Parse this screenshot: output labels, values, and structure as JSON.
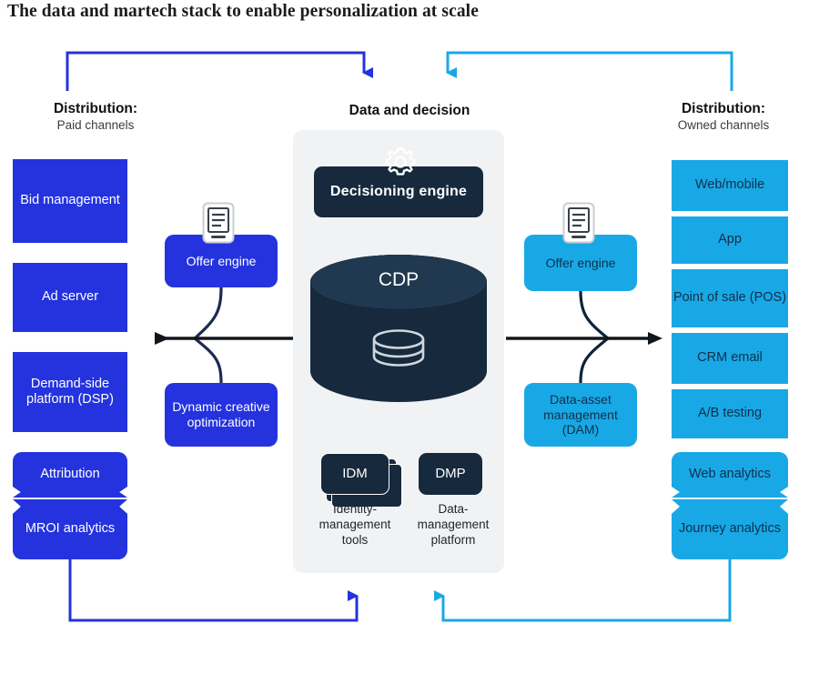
{
  "title": "The data and martech stack to enable personalization at scale",
  "colors": {
    "paid_blue": "#2433de",
    "owned_cyan": "#19a8e6",
    "center_navy": "#16293d",
    "center_panel_bg": "#f1f2f3",
    "arrow_dark": "#12161d",
    "title_text": "#1b1b1b"
  },
  "headings": {
    "left": {
      "title": "Distribution:",
      "subtitle": "Paid channels"
    },
    "middle": {
      "title": "Data and decision",
      "subtitle": ""
    },
    "right": {
      "title": "Distribution:",
      "subtitle": "Owned channels"
    }
  },
  "paid_channels": {
    "boxes": [
      {
        "label": "Bid management"
      },
      {
        "label": "Ad server"
      },
      {
        "label": "Demand-side platform (DSP)"
      }
    ],
    "grouped_pair": [
      {
        "label": "Attribution"
      },
      {
        "label": "MROI analytics"
      }
    ],
    "engines": [
      {
        "label": "Offer engine",
        "icon": "tablet-icon"
      },
      {
        "label": "Dynamic creative optimization",
        "icon": ""
      }
    ]
  },
  "data_and_decision": {
    "decisioning_engine": {
      "label": "Decisioning engine",
      "icon": "gear-icon"
    },
    "cdp": {
      "label": "CDP",
      "icon": "database-icon"
    },
    "sub_systems": [
      {
        "label": "IDM",
        "caption": "Identity-management tools"
      },
      {
        "label": "DMP",
        "caption": "Data-management platform"
      }
    ]
  },
  "owned_channels": {
    "boxes": [
      {
        "label": "Web/mobile"
      },
      {
        "label": "App"
      },
      {
        "label": "Point of sale (POS)"
      },
      {
        "label": "CRM email"
      },
      {
        "label": "A/B testing"
      }
    ],
    "grouped_pair": [
      {
        "label": "Web analytics"
      },
      {
        "label": "Journey analytics"
      }
    ],
    "engines": [
      {
        "label": "Offer engine",
        "icon": "tablet-icon"
      },
      {
        "label": "Data-asset management (DAM)",
        "icon": ""
      }
    ]
  }
}
